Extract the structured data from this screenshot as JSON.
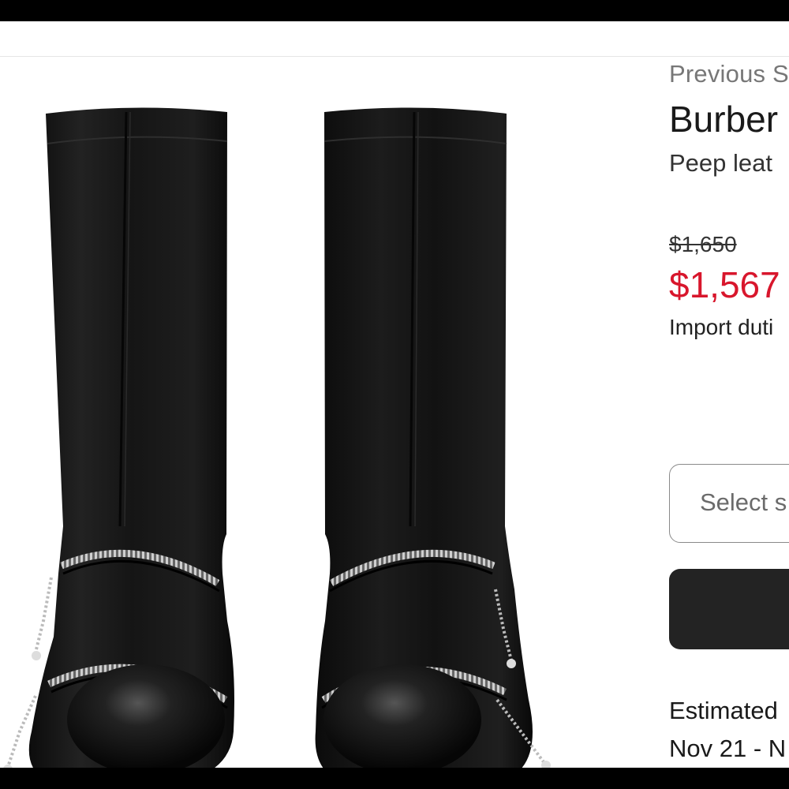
{
  "breadcrumb": "Previous S",
  "product": {
    "brand": "Burber",
    "name": "Peep leat",
    "original_price": "$1,650",
    "sale_price": "$1,567",
    "duties_note": "Import duti",
    "sale_color": "#d8162c"
  },
  "actions": {
    "select_size_label": "Select s",
    "add_to_bag_label": ""
  },
  "delivery": {
    "label": "Estimated",
    "dates": "Nov 21 - N"
  },
  "image": {
    "description_icon": "boots-product-image"
  }
}
